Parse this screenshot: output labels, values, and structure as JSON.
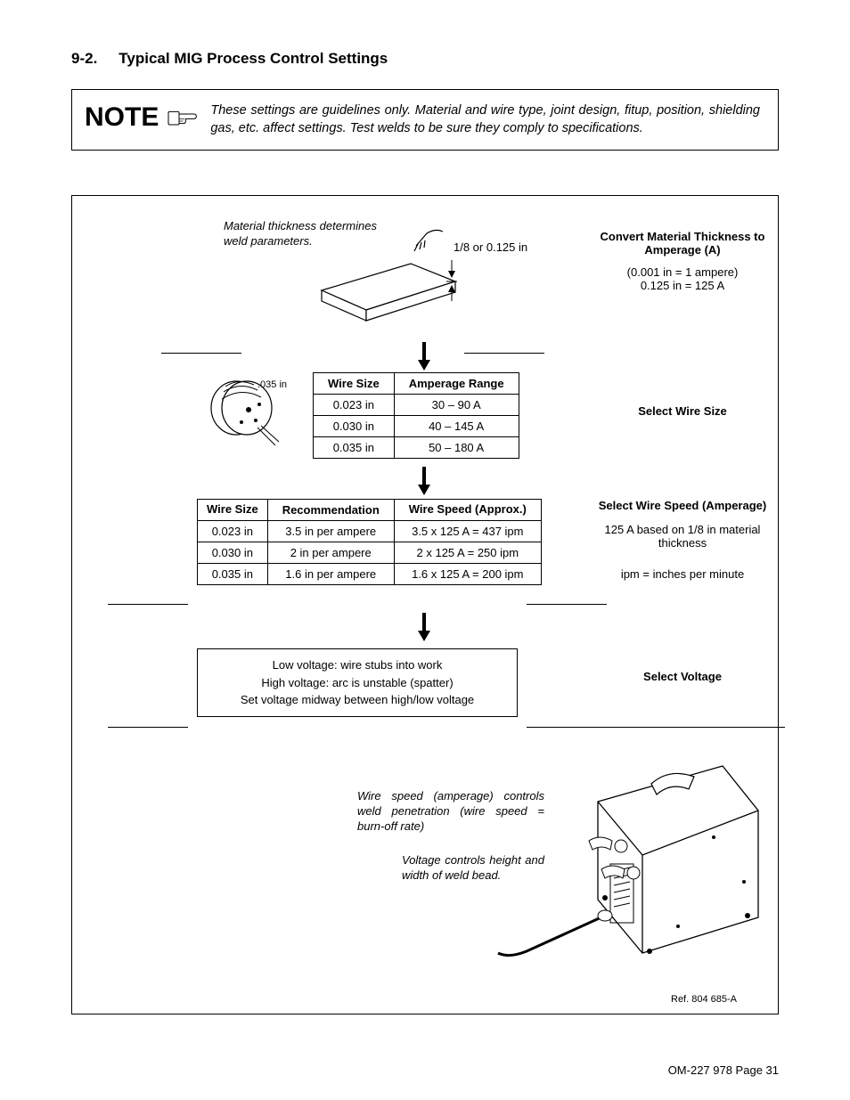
{
  "heading": {
    "num": "9-2.",
    "title": "Typical MIG Process Control Settings"
  },
  "note": {
    "label": "NOTE",
    "body": "These settings are guidelines only. Material and wire type, joint design, fitup, position, shielding gas, etc. affect settings. Test welds to be sure they comply to specifications."
  },
  "step1": {
    "caption": "Material thickness determines weld parameters.",
    "thickness_callout": "1/8 or 0.125 in",
    "side_title": "Convert Material Thickness to Amperage (A)",
    "side_line1": "(0.001 in = 1 ampere)",
    "side_line2": "0.125 in = 125 A"
  },
  "step2": {
    "spool_label": ".035 in",
    "tbl_h1": "Wire Size",
    "tbl_h2": "Amperage Range",
    "r1c1": "0.023 in",
    "r1c2": "30 – 90 A",
    "r2c1": "0.030 in",
    "r2c2": "40 – 145 A",
    "r3c1": "0.035 in",
    "r3c2": "50 – 180 A",
    "side_title": "Select Wire Size"
  },
  "step3": {
    "h1": "Wire Size",
    "h2": "Recommendation",
    "h3": "Wire Speed (Approx.)",
    "r1c1": "0.023 in",
    "r1c2": "3.5 in per ampere",
    "r1c3": "3.5 x 125 A = 437 ipm",
    "r2c1": "0.030 in",
    "r2c2": "2 in per ampere",
    "r2c3": "2 x 125 A = 250 ipm",
    "r3c1": "0.035 in",
    "r3c2": "1.6 in per ampere",
    "r3c3": "1.6 x 125 A = 200 ipm",
    "side_title": "Select Wire Speed (Amperage)",
    "side_line1": "125 A based on 1/8 in material thickness",
    "side_line2": "ipm = inches per minute"
  },
  "step4": {
    "l1": "Low voltage: wire stubs into work",
    "l2": "High voltage: arc is unstable (spatter)",
    "l3": "Set voltage midway between high/low voltage",
    "side_title": "Select Voltage"
  },
  "step5": {
    "caption1": "Wire speed (amperage) controls weld penetration (wire speed = burn-off rate)",
    "caption2": "Voltage controls height and width of weld bead."
  },
  "ref": "Ref. 804 685-A",
  "page_num": "OM-227 978 Page 31"
}
